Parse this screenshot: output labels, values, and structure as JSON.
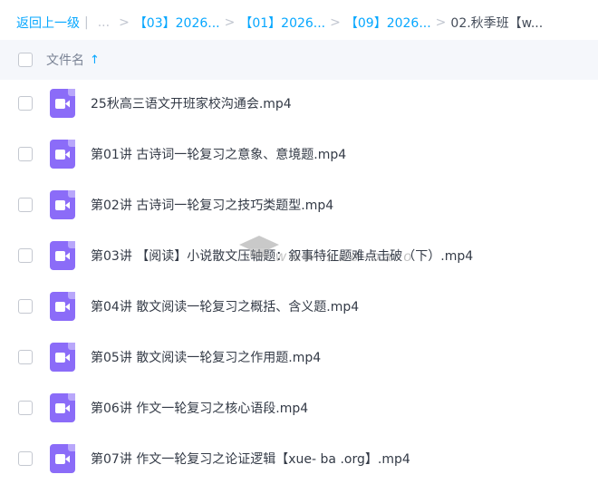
{
  "breadcrumb": {
    "back": "返回上一级",
    "divider": "|",
    "ellipsis": "...",
    "separator": ">",
    "items": [
      "【03】2026...",
      "【01】2026...",
      "【09】2026..."
    ],
    "current": "02.秋季班【w..."
  },
  "list_header": {
    "column_label": "文件名",
    "sort_arrow": "↑"
  },
  "file_icon": "video-file-icon",
  "files": [
    "25秋高三语文开班家校沟通会.mp4",
    "第01讲 古诗词一轮复习之意象、意境题.mp4",
    "第02讲 古诗词一轮复习之技巧类题型.mp4",
    "第03讲 【阅读】小说散文压轴题：叙事特征题难点击破（下）.mp4",
    "第04讲 散文阅读一轮复习之概括、含义题.mp4",
    "第05讲 散文阅读一轮复习之作用题.mp4",
    "第06讲 作文一轮复习之核心语段.mp4",
    "第07讲 作文一轮复习之论证逻辑【xue- ba .org】.mp4"
  ],
  "colors": {
    "accent": "#06a7ff",
    "video_icon": "#8b6cf8"
  }
}
